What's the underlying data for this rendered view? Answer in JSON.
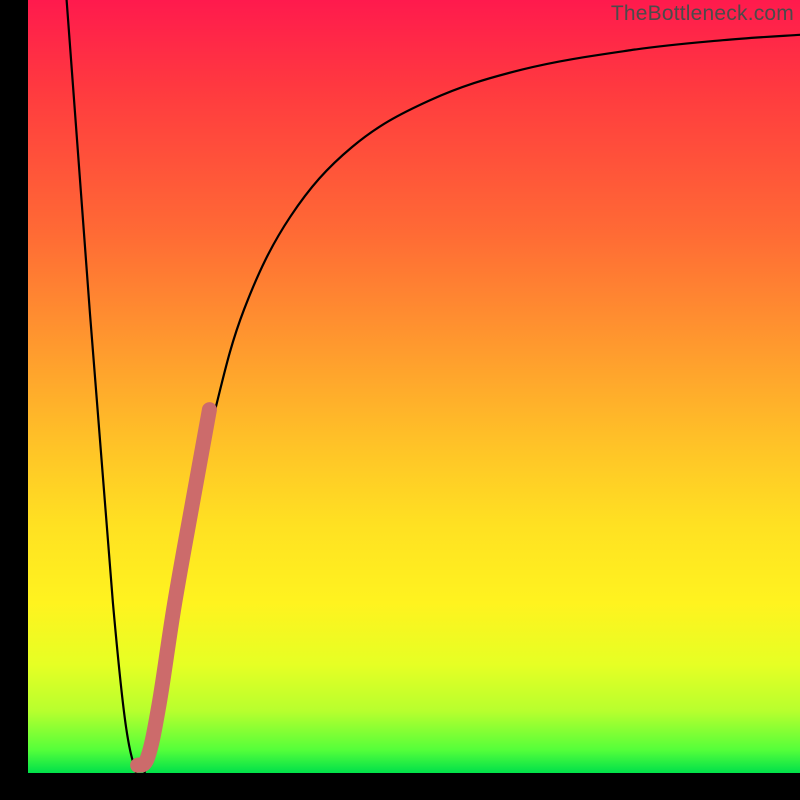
{
  "watermark": "TheBottleneck.com",
  "chart_data": {
    "type": "line",
    "title": "",
    "xlabel": "",
    "ylabel": "",
    "xlim": [
      0,
      100
    ],
    "ylim": [
      0,
      100
    ],
    "series": [
      {
        "name": "bottleneck-curve",
        "x": [
          5,
          11,
          14,
          16,
          18,
          20,
          24,
          28,
          34,
          42,
          52,
          64,
          78,
          90,
          100
        ],
        "values": [
          100,
          22,
          0,
          4,
          14,
          28,
          46,
          60,
          72,
          81,
          87,
          91,
          93.5,
          94.8,
          95.5
        ]
      }
    ],
    "highlight_segment": {
      "name": "emphasis-stroke",
      "color": "#cc6b6b",
      "x": [
        14.2,
        15.5,
        17,
        19,
        21.5,
        23.5
      ],
      "values": [
        1,
        2,
        9,
        22,
        36,
        47
      ]
    },
    "background_gradient": {
      "stops": [
        {
          "pos": 0,
          "color": "#ff1a4d"
        },
        {
          "pos": 50,
          "color": "#ffb528"
        },
        {
          "pos": 78,
          "color": "#fff31f"
        },
        {
          "pos": 100,
          "color": "#00e04a"
        }
      ]
    }
  }
}
